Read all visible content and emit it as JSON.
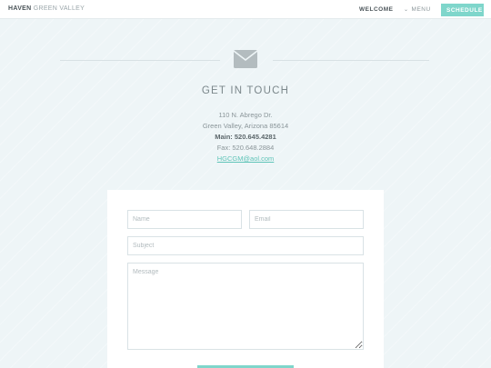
{
  "header": {
    "brand_bold": "HAVEN",
    "brand_light": "GREEN VALLEY",
    "nav_welcome": "WELCOME",
    "nav_menu": "MENU",
    "schedule_label": "SCHEDULE"
  },
  "hero": {
    "icon": "envelope-icon",
    "title": "GET IN TOUCH"
  },
  "contact": {
    "address1": "110 N. Abrego Dr.",
    "address2": "Green Valley, Arizona 85614",
    "phone": "Main: 520.645.4281",
    "fax": "Fax: 520.648.2884",
    "email": "HGCGM@aol.com"
  },
  "form": {
    "name_placeholder": "Name",
    "email_placeholder": "Email",
    "subject_placeholder": "Subject",
    "message_placeholder": "Message"
  },
  "colors": {
    "accent": "#7fd6cb",
    "background": "#eef5f7"
  }
}
